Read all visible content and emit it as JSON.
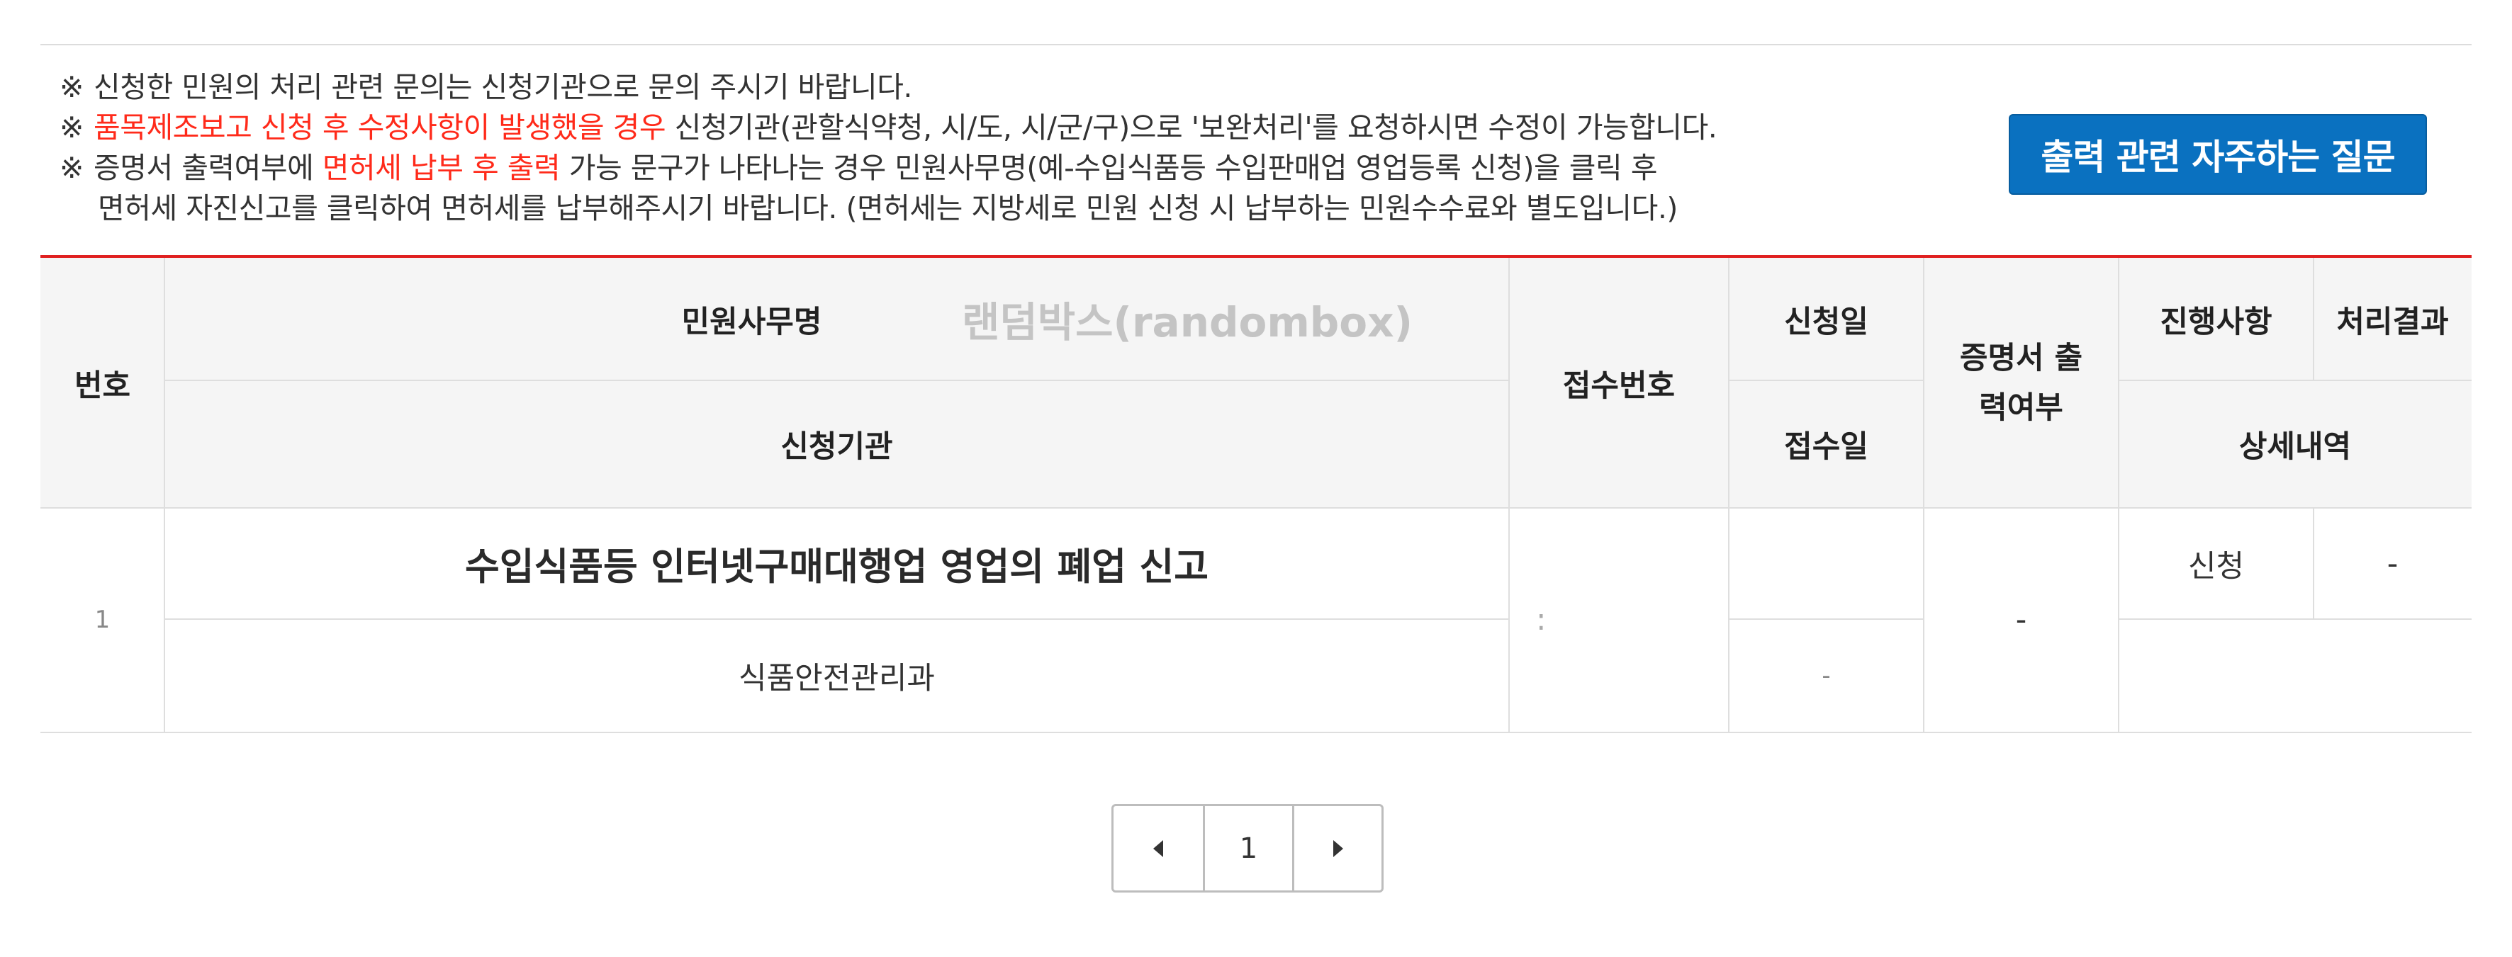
{
  "notices": [
    {
      "mark": "※",
      "text": "신청한 민원의 처리 관련 문의는 신청기관으로 문의 주시기 바랍니다."
    },
    {
      "mark": "※",
      "highlight": "품목제조보고 신청 후 수정사항이 발생했을 경우",
      "text": " 신청기관(관할식약청, 시/도, 시/군/구)으로 '보완처리'를 요청하시면 수정이 가능합니다."
    },
    {
      "mark": "※",
      "pre": "증명서 출력여부에 ",
      "highlight": "면허세 납부 후 출력",
      "text": " 가능 문구가 나타나는 경우 민원사무명(예-수입식품등 수입판매업 영업등록 신청)을 클릭 후"
    },
    {
      "text": "면허세 자진신고를 클릭하여 면허세를 납부해주시기 바랍니다. (면허세는 지방세로 민원 신청 시 납부하는 민원수수료와 별도입니다.)"
    }
  ],
  "faq_button": "출력 관련 자주하는 질문",
  "watermark": "랜덤박스(randombox)",
  "table": {
    "headers": {
      "no": "번호",
      "service_name": "민원사무명",
      "agency": "신청기관",
      "receipt_no": "접수번호",
      "apply_date": "신청일",
      "receipt_date": "접수일",
      "certificate": "증명서 출력여부",
      "status": "진행사항",
      "result": "처리결과",
      "detail": "상세내역"
    },
    "rows": [
      {
        "no": "1",
        "service_name": "수입식품등 인터넷구매대행업 영업의 폐업 신고",
        "agency": "식품안전관리과",
        "receipt_no": ":",
        "apply_date": "",
        "receipt_date": "-",
        "certificate": "-",
        "status": "신청",
        "result": "-",
        "detail": ""
      }
    ]
  },
  "pagination": {
    "current_page": "1"
  },
  "colors": {
    "accent_red": "#e02020",
    "button_blue": "#0a71c0",
    "highlight_red": "#ff2a1a"
  }
}
